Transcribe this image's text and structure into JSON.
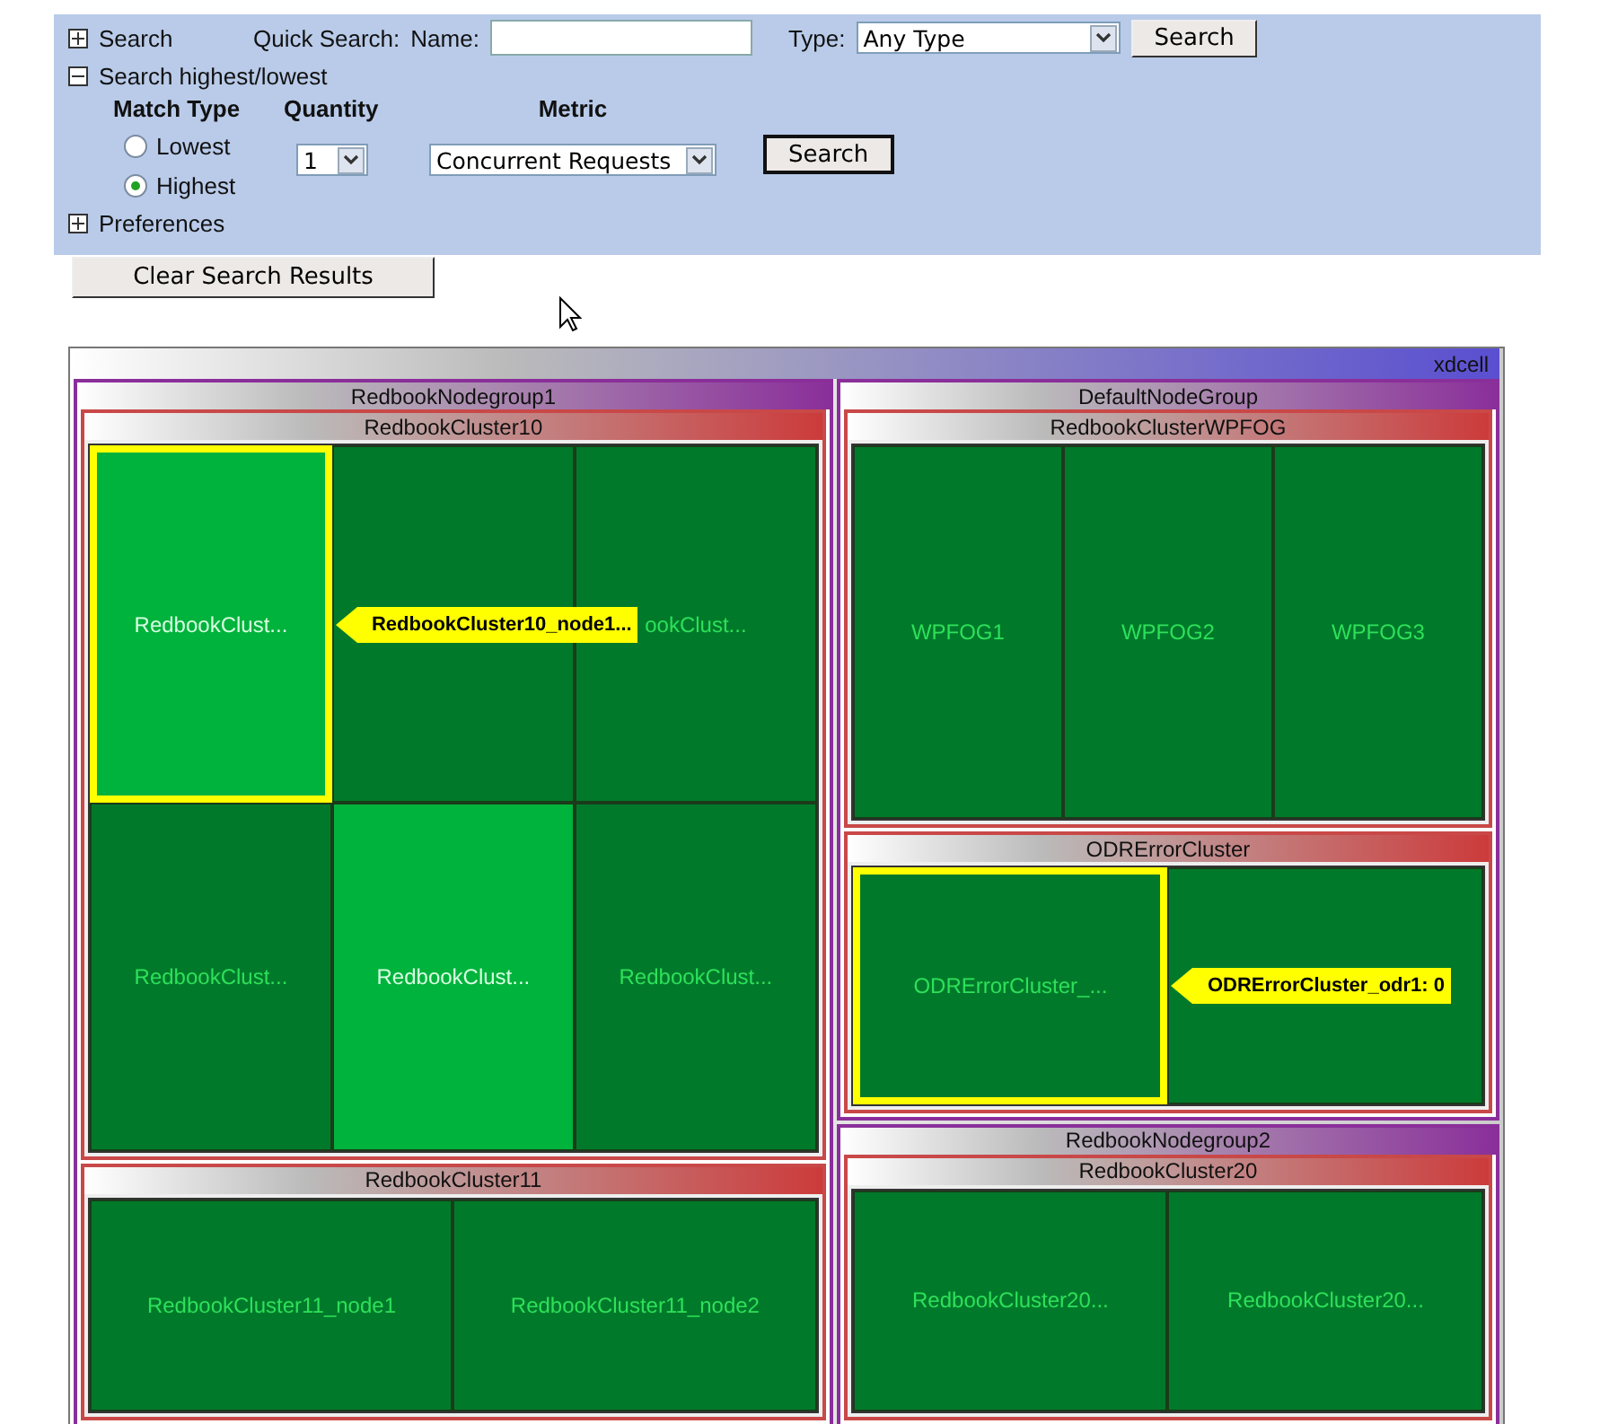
{
  "search_panel": {
    "search_section": {
      "label": "Search",
      "expanded": false
    },
    "quick_search": {
      "label": "Quick Search:",
      "name_label": "Name:",
      "type_label": "Type:",
      "type_value": "Any Type",
      "button": "Search"
    },
    "highlow_section": {
      "label": "Search highest/lowest",
      "expanded": true
    },
    "match_type": {
      "heading": "Match Type",
      "options": [
        {
          "label": "Lowest",
          "selected": false
        },
        {
          "label": "Highest",
          "selected": true
        }
      ]
    },
    "quantity": {
      "heading": "Quantity",
      "value": "1"
    },
    "metric": {
      "heading": "Metric",
      "value": "Concurrent Requests"
    },
    "highlow_button": "Search",
    "preferences_section": {
      "label": "Preferences",
      "expanded": false
    }
  },
  "clear_button": "Clear Search Results",
  "treemap": {
    "cell": "xdcell",
    "columns": [
      [
        {
          "name": "RedbookNodegroup1",
          "clusters": [
            {
              "name": "RedbookCluster10",
              "nodes": [
                {
                  "label": "RedbookClust...",
                  "color": "#00b33c",
                  "highlighted": true,
                  "callout": "RedbookCluster10_node1..."
                },
                {
                  "color": "#007a2a",
                  "highlighted": false
                },
                {
                  "label": "ookClust...",
                  "color": "#007a2a",
                  "highlighted": false
                },
                {
                  "label": "RedbookClust...",
                  "color": "#007a2a",
                  "highlighted": false
                },
                {
                  "label": "RedbookClust...",
                  "color": "#00b33c",
                  "highlighted": false
                },
                {
                  "label": "RedbookClust...",
                  "color": "#007a2a",
                  "highlighted": false
                }
              ]
            },
            {
              "name": "RedbookCluster11",
              "nodes": [
                {
                  "label": "RedbookCluster11_node1",
                  "color": "#007a2a",
                  "highlighted": false
                },
                {
                  "label": "RedbookCluster11_node2",
                  "color": "#007a2a",
                  "highlighted": false
                }
              ]
            }
          ]
        }
      ],
      [
        {
          "name": "DefaultNodeGroup",
          "clusters": [
            {
              "name": "RedbookClusterWPFOG",
              "nodes": [
                {
                  "label": "WPFOG1",
                  "color": "#007a2a",
                  "highlighted": false
                },
                {
                  "label": "WPFOG2",
                  "color": "#007a2a",
                  "highlighted": false
                },
                {
                  "label": "WPFOG3",
                  "color": "#007a2a",
                  "highlighted": false
                }
              ]
            },
            {
              "name": "ODRErrorCluster",
              "nodes": [
                {
                  "label": "ODRErrorCluster_...",
                  "color": "#007a2a",
                  "highlighted": true,
                  "callout": "ODRErrorCluster_odr1: 0"
                },
                {
                  "color": "#007a2a",
                  "highlighted": false
                }
              ]
            }
          ]
        },
        {
          "name": "RedbookNodegroup2",
          "clusters": [
            {
              "name": "RedbookCluster20",
              "nodes": [
                {
                  "label": "RedbookCluster20...",
                  "color": "#007a2a",
                  "highlighted": false
                },
                {
                  "label": "RedbookCluster20...",
                  "color": "#007a2a",
                  "highlighted": false
                }
              ]
            }
          ]
        }
      ]
    ]
  }
}
